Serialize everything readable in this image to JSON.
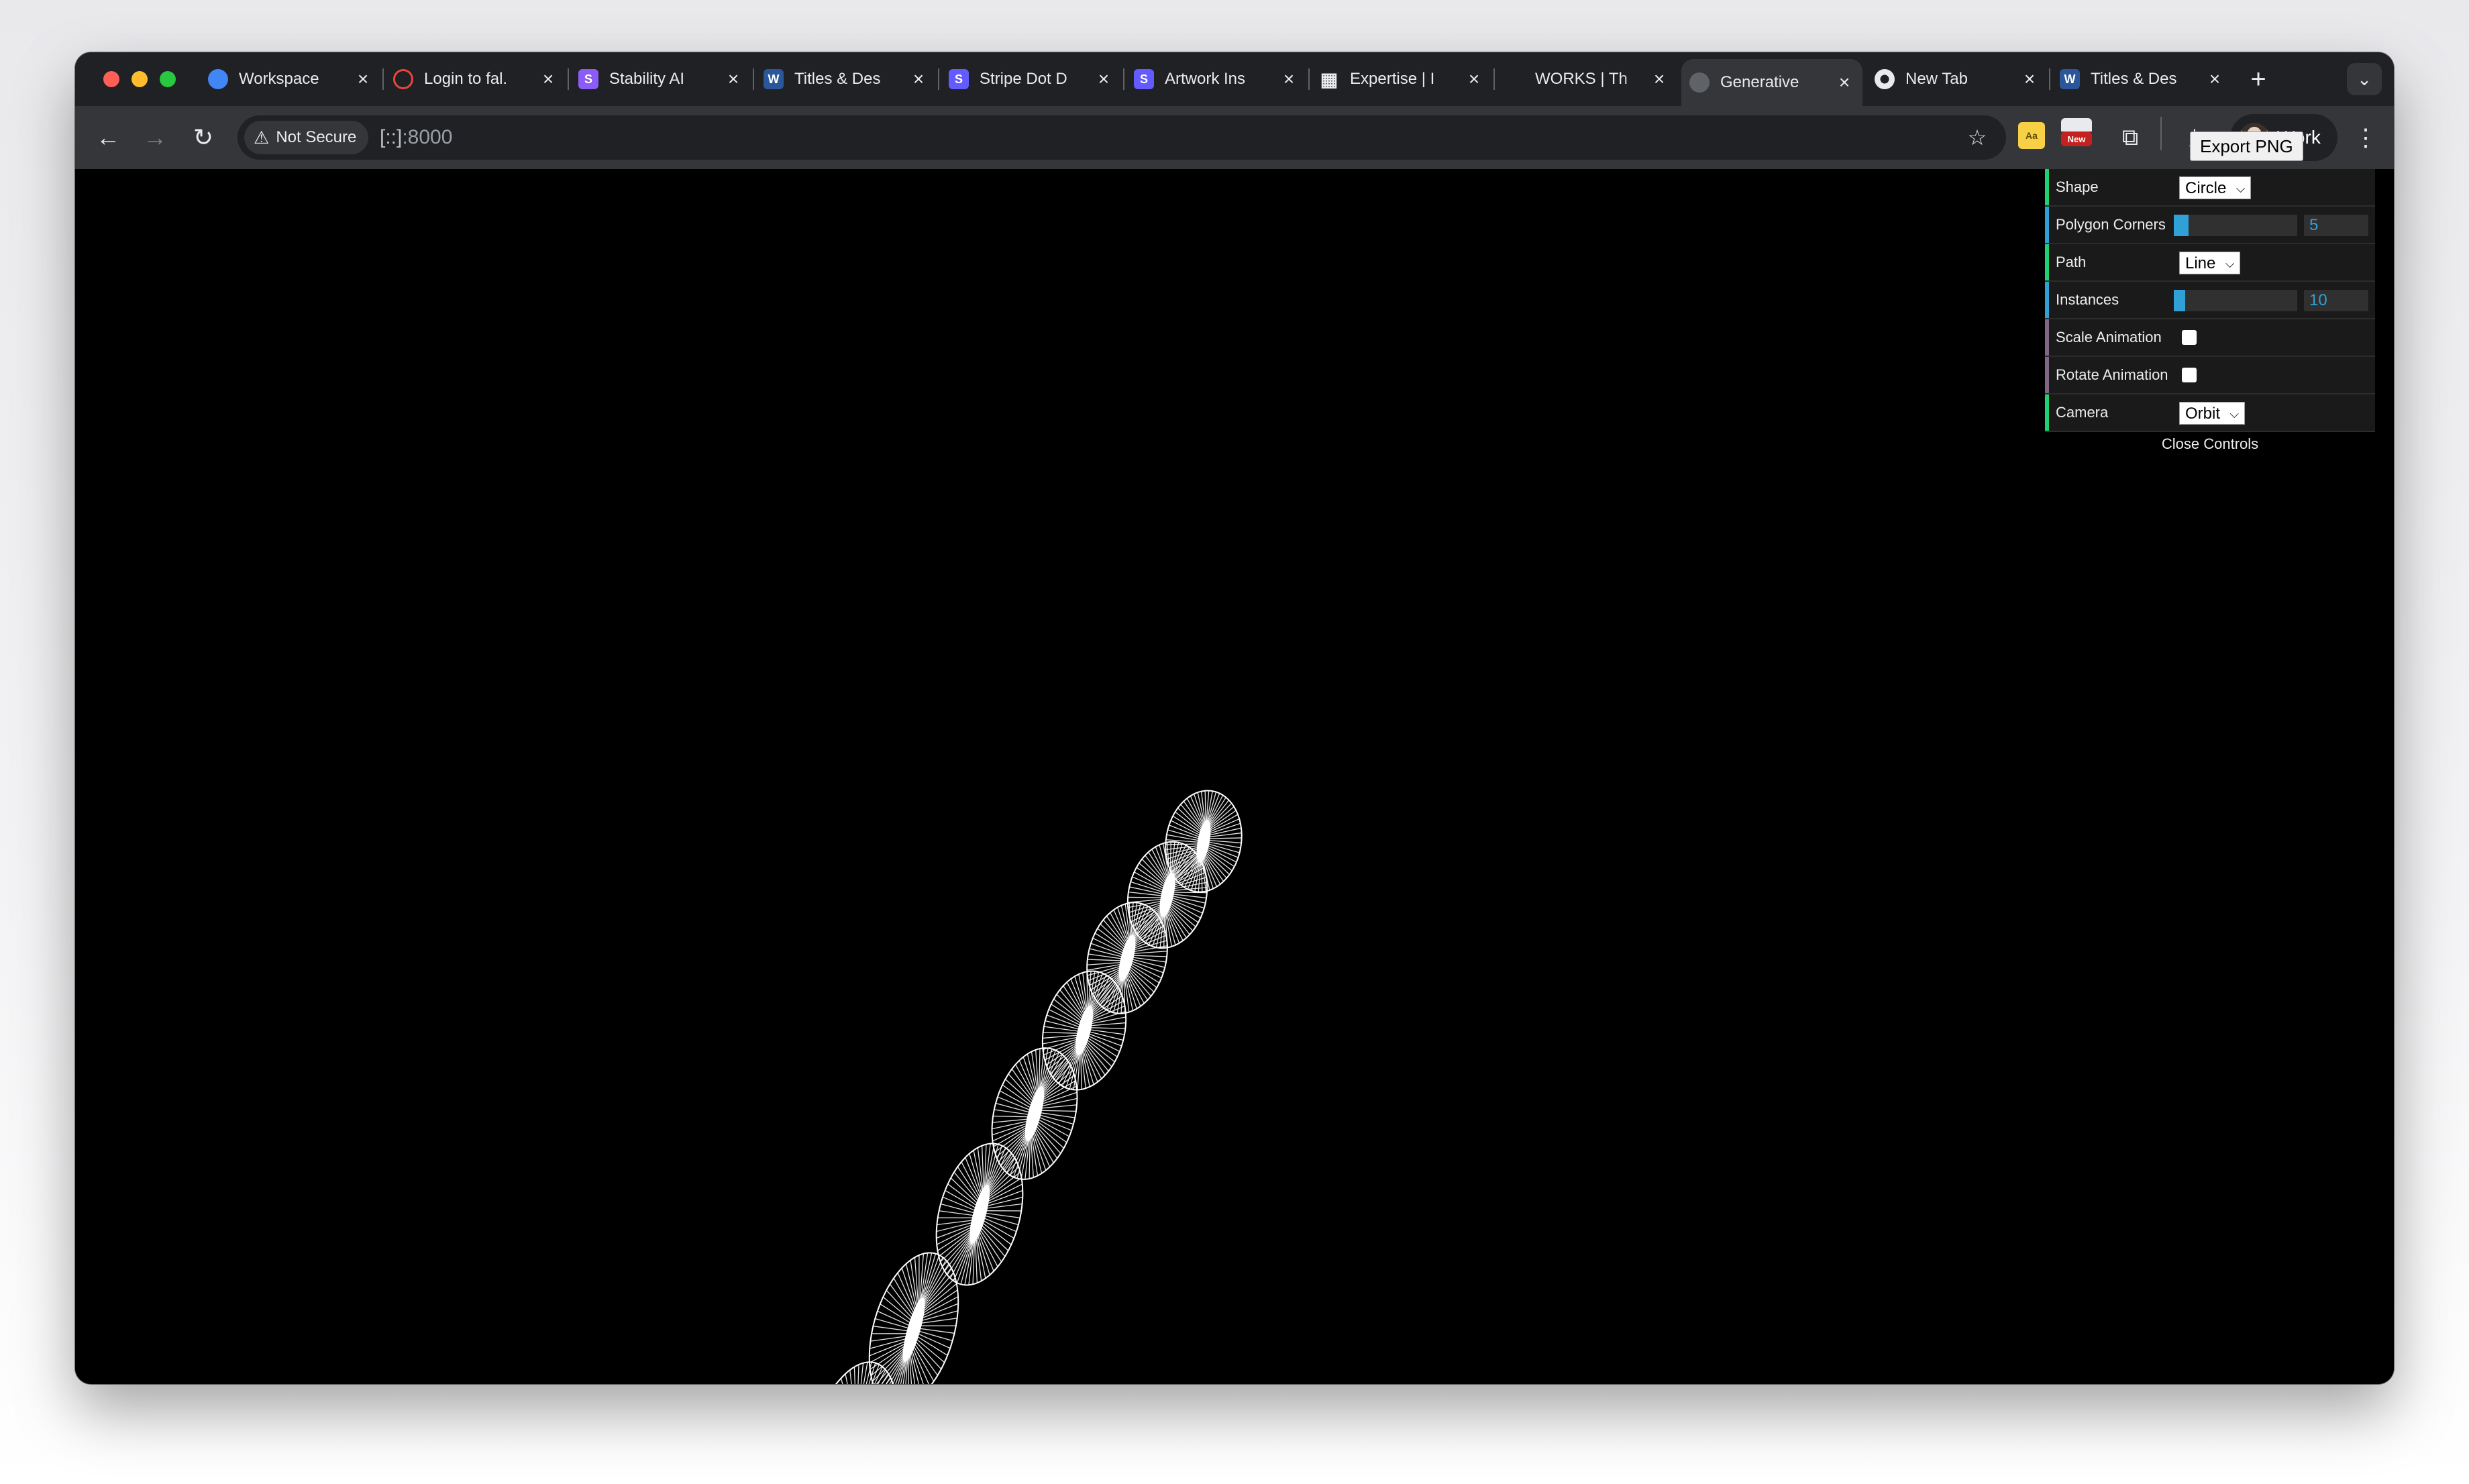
{
  "tabs": [
    {
      "title": "Workspace",
      "icon": "workspace-favicon",
      "color": "#4285f4"
    },
    {
      "title": "Login to fal.",
      "icon": "fal-favicon",
      "color": "#e8453c"
    },
    {
      "title": "Stability AI",
      "icon": "stability-favicon",
      "color": "#8b5cf6"
    },
    {
      "title": "Titles & Des",
      "icon": "word-favicon",
      "color": "#2b579a"
    },
    {
      "title": "Stripe Dot D",
      "icon": "stripe-favicon",
      "color": "#635bff"
    },
    {
      "title": "Artwork Ins",
      "icon": "stripe-favicon",
      "color": "#635bff"
    },
    {
      "title": "Expertise | I",
      "icon": "grid-favicon",
      "color": "#9aa0a6"
    },
    {
      "title": "WORKS | Th",
      "icon": "none",
      "color": "#202124"
    },
    {
      "title": "Generative",
      "icon": "globe-favicon",
      "color": "#5f6368",
      "active": true
    },
    {
      "title": "New Tab",
      "icon": "chrome-favicon",
      "color": "#e8eaed"
    },
    {
      "title": "Titles & Des",
      "icon": "word-favicon",
      "color": "#2b579a"
    }
  ],
  "toolbar": {
    "security_label": "Not Secure",
    "url_host": "[::]",
    "url_port": ":8000",
    "profile_label": "Work",
    "ext_new_badge": "New",
    "ext_dict_label": "Aa"
  },
  "gui": {
    "rows": [
      {
        "label": "Shape",
        "type": "select",
        "value": "Circle",
        "stripe": "#1ed36f"
      },
      {
        "label": "Polygon Corners",
        "type": "slider",
        "value": "5",
        "fraction": 0.12,
        "stripe": "#2fa1d6"
      },
      {
        "label": "Path",
        "type": "select",
        "value": "Line",
        "stripe": "#1ed36f"
      },
      {
        "label": "Instances",
        "type": "slider",
        "value": "10",
        "fraction": 0.09,
        "stripe": "#2fa1d6"
      },
      {
        "label": "Scale Animation",
        "type": "checkbox",
        "checked": false,
        "stripe": "#806787"
      },
      {
        "label": "Rotate Animation",
        "type": "checkbox",
        "checked": false,
        "stripe": "#806787"
      },
      {
        "label": "Camera",
        "type": "select",
        "value": "Orbit",
        "stripe": "#1ed36f"
      }
    ],
    "close_label": "Close Controls",
    "export_label": "Export PNG"
  }
}
